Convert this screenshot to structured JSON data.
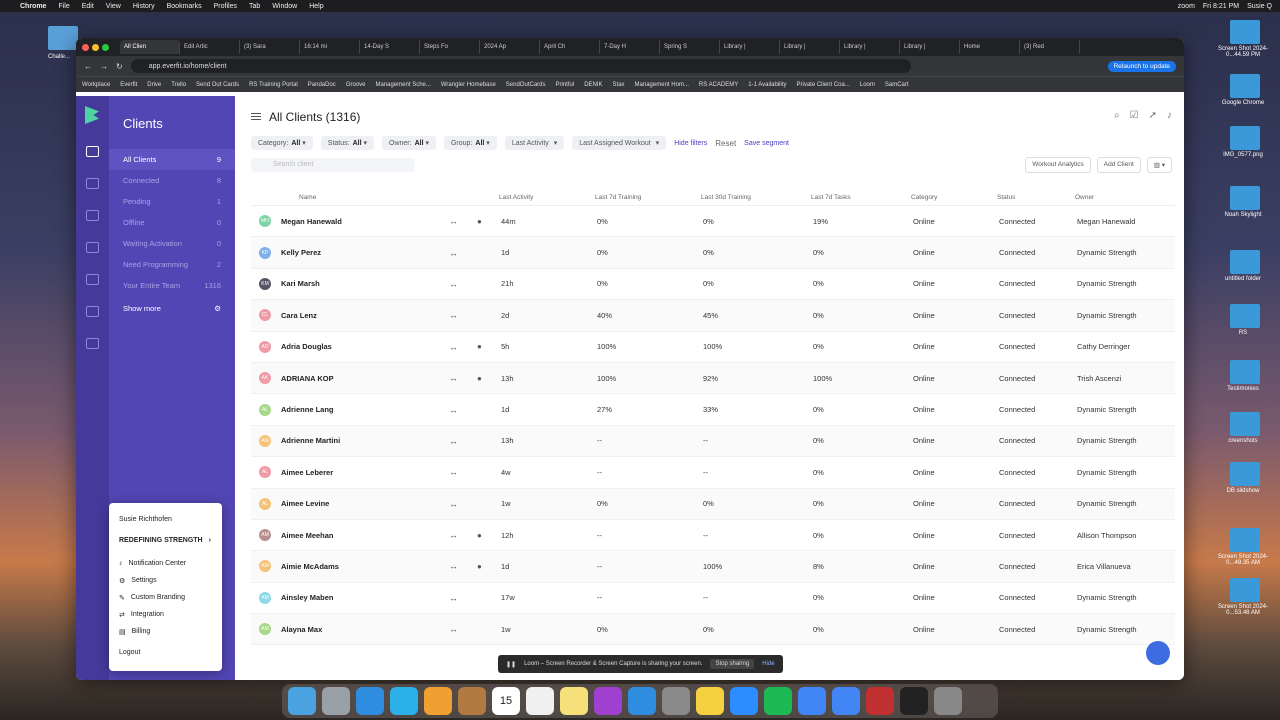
{
  "menubar": {
    "app": "Chrome",
    "items": [
      "File",
      "Edit",
      "View",
      "History",
      "Bookmarks",
      "Profiles",
      "Tab",
      "Window",
      "Help"
    ],
    "clock": "Fri 8:21 PM",
    "user": "Susie Q",
    "zoom": "zoom"
  },
  "desktop": {
    "left_label": "Challe...",
    "right": [
      {
        "label": "Screen Shot 2024-0...44.59 PM"
      },
      {
        "label": "Google Chrome"
      },
      {
        "label": "IMG_0577.png"
      },
      {
        "label": "Noah Skylight"
      },
      {
        "label": "untitled folder"
      },
      {
        "label": "RS"
      },
      {
        "label": "Testimonies"
      },
      {
        "label": "creenshots"
      },
      {
        "label": "DB slidshow"
      },
      {
        "label": "Screen Shot 2024-0...49.35 AM"
      },
      {
        "label": "Screen Shot 2024-0...53.48 AM"
      }
    ]
  },
  "browser": {
    "tabs": [
      "All Clien",
      "Edit Artic",
      "(3) Sara",
      "16:14 mi",
      "14-Day S",
      "Steps Fo",
      "2024 Ap",
      "April Ch",
      "7-Day H",
      "Spring S",
      "Library |",
      "Library |",
      "Library |",
      "Library |",
      "Home",
      "(3) Red"
    ],
    "url": "app.everfit.io/home/client",
    "relaunch": "Relaunch to update",
    "bookmarks": [
      "Workplace",
      "Everfit",
      "Drive",
      "Trello",
      "Send Out Cards",
      "RS Training Portal",
      "PandaDoc",
      "Groove",
      "Management Sche...",
      "Wrangler Homebase",
      "SendOutCards",
      "Printful",
      "DENIK",
      "Stax",
      "Management Hom...",
      "RS ACADEMY",
      "1-1 Availability",
      "Private Client Coa...",
      "Loom",
      "SamCart"
    ]
  },
  "nav": {
    "title": "Clients",
    "items": [
      {
        "label": "All Clients",
        "count": "9"
      },
      {
        "label": "Connected",
        "count": "8"
      },
      {
        "label": "Pending",
        "count": "1"
      },
      {
        "label": "Offline",
        "count": "0"
      },
      {
        "label": "Waiting Activation",
        "count": "0"
      },
      {
        "label": "Need Programming",
        "count": "2"
      },
      {
        "label": "Your Entire Team",
        "count": "1316"
      }
    ],
    "show_more": "Show more"
  },
  "main": {
    "title": "All Clients (1316)",
    "filters": [
      {
        "label": "Category:",
        "value": "All"
      },
      {
        "label": "Status:",
        "value": "All"
      },
      {
        "label": "Owner:",
        "value": "All"
      },
      {
        "label": "Group:",
        "value": "All"
      },
      {
        "label": "Last Activity",
        "value": ""
      },
      {
        "label": "Last Assigned Workout",
        "value": ""
      }
    ],
    "hide_filters": "Hide filters",
    "reset": "Reset",
    "save_segment": "Save segment",
    "search_placeholder": "Search client",
    "workout_analytics": "Workout Analytics",
    "add_client": "Add Client",
    "columns": [
      "Name",
      "Last Activity",
      "Last 7d Training",
      "Last 30d Training",
      "Last 7d Tasks",
      "Category",
      "Status",
      "Owner"
    ],
    "rows": [
      {
        "initials": "MH",
        "color": "#7fd4a8",
        "name": "Megan Hanewald",
        "chat": true,
        "activity": "44m",
        "t7": "0%",
        "t30": "0%",
        "tasks": "19%",
        "category": "Online",
        "status": "Connected",
        "owner": "Megan Hanewald"
      },
      {
        "initials": "KP",
        "color": "#7fb0e8",
        "name": "Kelly Perez",
        "chat": false,
        "activity": "1d",
        "t7": "0%",
        "t30": "0%",
        "tasks": "0%",
        "category": "Online",
        "status": "Connected",
        "owner": "Dynamic Strength"
      },
      {
        "initials": "KM",
        "color": "#555566",
        "name": "Kari Marsh",
        "chat": false,
        "activity": "21h",
        "t7": "0%",
        "t30": "0%",
        "tasks": "0%",
        "category": "Online",
        "status": "Connected",
        "owner": "Dynamic Strength"
      },
      {
        "initials": "CL",
        "color": "#f09aa8",
        "name": "Cara Lenz",
        "chat": false,
        "activity": "2d",
        "t7": "40%",
        "t30": "45%",
        "tasks": "0%",
        "category": "Online",
        "status": "Connected",
        "owner": "Dynamic Strength"
      },
      {
        "initials": "AD",
        "color": "#f09aa8",
        "name": "Adria Douglas",
        "chat": true,
        "activity": "5h",
        "t7": "100%",
        "t30": "100%",
        "tasks": "0%",
        "category": "Online",
        "status": "Connected",
        "owner": "Cathy Derringer"
      },
      {
        "initials": "AK",
        "color": "#f09aa8",
        "name": "ADRIANA KOP",
        "chat": true,
        "activity": "13h",
        "t7": "100%",
        "t30": "92%",
        "tasks": "100%",
        "category": "Online",
        "status": "Connected",
        "owner": "Trish Ascenzi"
      },
      {
        "initials": "AL",
        "color": "#a8d88a",
        "name": "Adrienne Lang",
        "chat": false,
        "activity": "1d",
        "t7": "27%",
        "t30": "33%",
        "tasks": "0%",
        "category": "Online",
        "status": "Connected",
        "owner": "Dynamic Strength"
      },
      {
        "initials": "AM",
        "color": "#f5c27a",
        "name": "Adrienne Martini",
        "chat": false,
        "activity": "13h",
        "t7": "--",
        "t30": "--",
        "tasks": "0%",
        "category": "Online",
        "status": "Connected",
        "owner": "Dynamic Strength"
      },
      {
        "initials": "AL",
        "color": "#f09aa8",
        "name": "Aimee Leberer",
        "chat": false,
        "activity": "4w",
        "t7": "--",
        "t30": "--",
        "tasks": "0%",
        "category": "Online",
        "status": "Connected",
        "owner": "Dynamic Strength"
      },
      {
        "initials": "AL",
        "color": "#f5c27a",
        "name": "Aimee Levine",
        "chat": false,
        "activity": "1w",
        "t7": "0%",
        "t30": "0%",
        "tasks": "0%",
        "category": "Online",
        "status": "Connected",
        "owner": "Dynamic Strength"
      },
      {
        "initials": "AM",
        "color": "#b88f8f",
        "name": "Aimee Meehan",
        "chat": true,
        "activity": "12h",
        "t7": "--",
        "t30": "--",
        "tasks": "0%",
        "category": "Online",
        "status": "Connected",
        "owner": "Allison Thompson"
      },
      {
        "initials": "AM",
        "color": "#f5c27a",
        "name": "Aimie McAdams",
        "chat": true,
        "activity": "1d",
        "t7": "--",
        "t30": "100%",
        "tasks": "8%",
        "category": "Online",
        "status": "Connected",
        "owner": "Erica Villanueva"
      },
      {
        "initials": "AM",
        "color": "#8fd8e8",
        "name": "Ainsley Maben",
        "chat": false,
        "activity": "17w",
        "t7": "--",
        "t30": "--",
        "tasks": "0%",
        "category": "Online",
        "status": "Connected",
        "owner": "Dynamic Strength"
      },
      {
        "initials": "AM",
        "color": "#a8d88a",
        "name": "Alayna Max",
        "chat": false,
        "activity": "1w",
        "t7": "0%",
        "t30": "0%",
        "tasks": "0%",
        "category": "Online",
        "status": "Connected",
        "owner": "Dynamic Strength"
      }
    ]
  },
  "popup": {
    "user": "Susie Richthofen",
    "team": "REDEFINING STRENGTH",
    "items": [
      "Notification Center",
      "Settings",
      "Custom Branding",
      "Integration",
      "Billing"
    ],
    "logout": "Logout"
  },
  "loom": {
    "text": "Loom – Screen Recorder & Screen Capture is sharing your screen.",
    "stop": "Stop sharing",
    "hide": "Hide"
  },
  "dock": {
    "calendar_day": "15"
  },
  "colors": {
    "nav_bg": "#5246b5",
    "rail_bg": "#453a9c",
    "accent": "#4a3fc0",
    "brand": "#4fd3a3"
  }
}
